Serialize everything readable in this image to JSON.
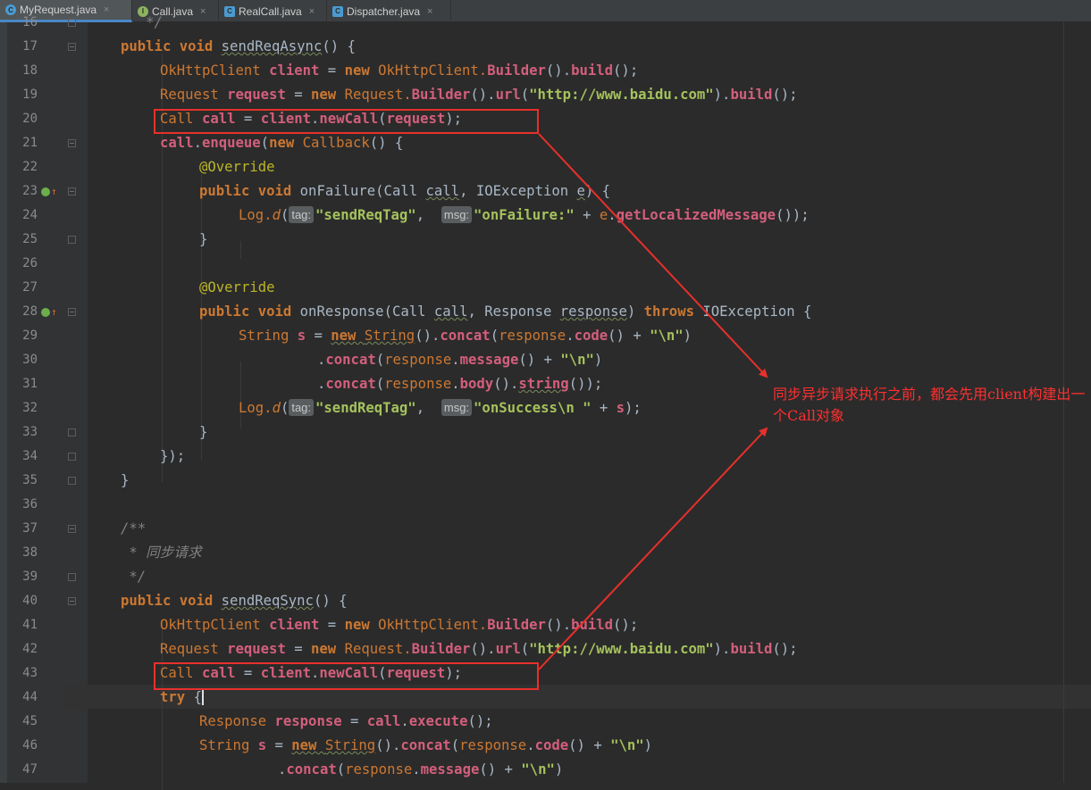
{
  "tabs": [
    {
      "label": "MyRequest.java",
      "icon": "class-icon",
      "active": true
    },
    {
      "label": "Call.java",
      "icon": "interface-icon",
      "active": false
    },
    {
      "label": "RealCall.java",
      "icon": "class-icon",
      "active": false
    },
    {
      "label": "Dispatcher.java",
      "icon": "class-icon",
      "active": false
    }
  ],
  "close_glyph": "×",
  "line_numbers": [
    "16",
    "17",
    "18",
    "19",
    "20",
    "21",
    "22",
    "23",
    "24",
    "25",
    "26",
    "27",
    "28",
    "29",
    "30",
    "31",
    "32",
    "33",
    "34",
    "35",
    "36",
    "37",
    "38",
    "39",
    "40",
    "41",
    "42",
    "43",
    "44",
    "45",
    "46",
    "47"
  ],
  "hints": {
    "tag": "tag:",
    "msg": "msg:"
  },
  "annotation": {
    "note": "同步异步请求执行之前，都会先用client构建出一个Call对象",
    "color": "#ff2f2f"
  },
  "colors": {
    "keyword": "#cc7832",
    "string": "#a5c25c",
    "variable": "#d35f7c",
    "annotation": "#bbb529",
    "comment": "#808080",
    "background": "#2b2b2b",
    "highlight_box": "#e8302c"
  },
  "code": {
    "l16": "   */",
    "l17_kw": "public void ",
    "l17_m": "sendReqAsync",
    "l17_r": "() {",
    "l18_t": "OkHttpClient ",
    "l18_v": "client",
    "l18_r1": " = ",
    "l18_new": "new ",
    "l18_t2": "OkHttpClient.",
    "l18_b": "Builder",
    "l18_r2": "().",
    "l18_bu": "build",
    "l18_r3": "();",
    "l19_t": "Request ",
    "l19_v": "request",
    "l19_r1": " = ",
    "l19_new": "new ",
    "l19_t2": "Request.",
    "l19_b": "Builder",
    "l19_r2": "().",
    "l19_url": "url",
    "l19_r3": "(",
    "l19_s": "\"http://www.baidu.com\"",
    "l19_r4": ").",
    "l19_bu": "build",
    "l19_r5": "();",
    "l20_t": "Call ",
    "l20_v": "call",
    "l20_r1": " = ",
    "l20_c": "client",
    "l20_r2": ".",
    "l20_m": "newCall",
    "l20_r3": "(",
    "l20_a": "request",
    "l20_r4": ");",
    "l21_v": "call",
    "l21_r1": ".",
    "l21_m": "enqueue",
    "l21_r2": "(",
    "l21_new": "new ",
    "l21_t": "Callback",
    "l21_r3": "() {",
    "l22": "@Override",
    "l23_kw": "public void ",
    "l23_m": "onFailure",
    "l23_r1": "(Call ",
    "l23_a1": "call",
    "l23_r2": ", IOException ",
    "l23_a2": "e",
    "l23_r3": ") {",
    "l24_a": "Log.",
    "l24_d": "d",
    "l24_r1": "(",
    "l24_s1": "\"sendReqTag\"",
    "l24_r2": ",  ",
    "l24_s2": "\"onFailure:\"",
    "l24_r3": " + ",
    "l24_e": "e",
    "l24_r4": ".",
    "l24_m": "getLocalizedMessage",
    "l24_r5": "());",
    "l25": "}",
    "l27": "@Override",
    "l28_kw": "public void ",
    "l28_m": "onResponse",
    "l28_r1": "(Call ",
    "l28_a1": "call",
    "l28_r2": ", Response ",
    "l28_a2": "response",
    "l28_r3": ") ",
    "l28_th": "throws ",
    "l28_r4": "IOException {",
    "l29_t": "String ",
    "l29_v": "s",
    "l29_r1": " = ",
    "l29_new": "new ",
    "l29_st": "String",
    "l29_r2": "().",
    "l29_c": "concat",
    "l29_r3": "(",
    "l29_re": "response",
    "l29_r4": ".",
    "l29_m": "code",
    "l29_r5": "() + ",
    "l29_s": "\"\\n\"",
    "l29_r6": ")",
    "l30_r1": ".",
    "l30_c": "concat",
    "l30_r2": "(",
    "l30_re": "response",
    "l30_r3": ".",
    "l30_m": "message",
    "l30_r4": "() + ",
    "l30_s": "\"\\n\"",
    "l30_r5": ")",
    "l31_r1": ".",
    "l31_c": "concat",
    "l31_r2": "(",
    "l31_re": "response",
    "l31_r3": ".",
    "l31_m": "body",
    "l31_r4": "().",
    "l31_m2": "string",
    "l31_r5": "());",
    "l32_a": "Log.",
    "l32_d": "d",
    "l32_r1": "(",
    "l32_s1": "\"sendReqTag\"",
    "l32_r2": ",  ",
    "l32_s2": "\"onSuccess\\n \"",
    "l32_r3": " + ",
    "l32_v": "s",
    "l32_r4": ");",
    "l33": "}",
    "l34": "});",
    "l35": "}",
    "l37": "/**",
    "l38": " * 同步请求",
    "l39": " */",
    "l40_kw": "public void ",
    "l40_m": "sendReqSync",
    "l40_r": "() {",
    "l41_t": "OkHttpClient ",
    "l41_v": "client",
    "l41_r1": " = ",
    "l41_new": "new ",
    "l41_t2": "OkHttpClient.",
    "l41_b": "Builder",
    "l41_r2": "().",
    "l41_bu": "build",
    "l41_r3": "();",
    "l42_t": "Request ",
    "l42_v": "request",
    "l42_r1": " = ",
    "l42_new": "new ",
    "l42_t2": "Request.",
    "l42_b": "Builder",
    "l42_r2": "().",
    "l42_url": "url",
    "l42_r3": "(",
    "l42_s": "\"http://www.baidu.com\"",
    "l42_r4": ").",
    "l42_bu": "build",
    "l42_r5": "();",
    "l43_t": "Call ",
    "l43_v": "call",
    "l43_r1": " = ",
    "l43_c": "client",
    "l43_r2": ".",
    "l43_m": "newCall",
    "l43_r3": "(",
    "l43_a": "request",
    "l43_r4": ");",
    "l44_kw": "try ",
    "l44_r": "{",
    "l45_t": "Response ",
    "l45_v": "response",
    "l45_r1": " = ",
    "l45_c": "call",
    "l45_r2": ".",
    "l45_m": "execute",
    "l45_r3": "();",
    "l46_t": "String ",
    "l46_v": "s",
    "l46_r1": " = ",
    "l46_new": "new ",
    "l46_st": "String",
    "l46_r2": "().",
    "l46_c": "concat",
    "l46_r3": "(",
    "l46_re": "response",
    "l46_r4": ".",
    "l46_m": "code",
    "l46_r5": "() + ",
    "l46_s": "\"\\n\"",
    "l46_r6": ")",
    "l47_r1": ".",
    "l47_c": "concat",
    "l47_r2": "(",
    "l47_re": "response",
    "l47_r3": ".",
    "l47_m": "message",
    "l47_r4": "() + ",
    "l47_s": "\"\\n\"",
    "l47_r5": ")"
  }
}
